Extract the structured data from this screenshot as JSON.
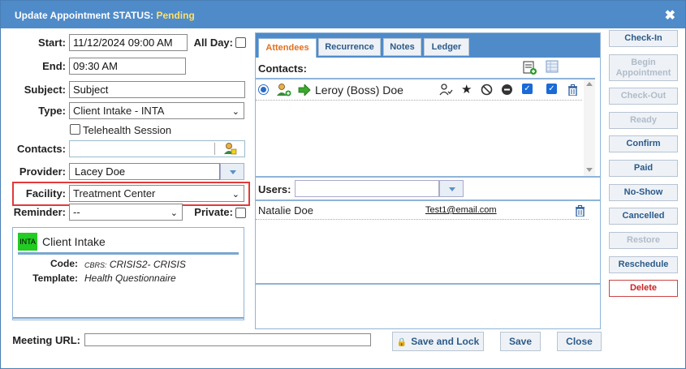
{
  "dialog": {
    "title_prefix": "Update Appointment STATUS: ",
    "status": "Pending",
    "close_glyph": "✖"
  },
  "form": {
    "start_label": "Start:",
    "start_value": "11/12/2024 09:00 AM",
    "allday_label": "All Day:",
    "end_label": "End:",
    "end_value": "09:30 AM",
    "subject_label": "Subject:",
    "subject_value": "Subject",
    "type_label": "Type:",
    "type_value": "Client Intake - INTA",
    "telehealth_label": "Telehealth Session",
    "contacts_label": "Contacts:",
    "provider_label": "Provider:",
    "provider_value": "Lacey Doe",
    "facility_label": "Facility:",
    "facility_value": "Treatment Center",
    "reminder_label": "Reminder:",
    "reminder_value": "--",
    "private_label": "Private:",
    "meeting_url_label": "Meeting URL:"
  },
  "type_card": {
    "badge": "INTA",
    "badge_color": "#22cc22",
    "title": "Client Intake",
    "code_label": "Code:",
    "code_prefix": "CBRS:",
    "code_value": " CRISIS2- CRISIS",
    "template_label": "Template:",
    "template_value": "Health Questionnaire"
  },
  "tabs": [
    {
      "label": "Attendees",
      "active": true
    },
    {
      "label": "Recurrence",
      "active": false
    },
    {
      "label": "Notes",
      "active": false
    },
    {
      "label": "Ledger",
      "active": false
    }
  ],
  "attendees": {
    "contacts_heading": "Contacts:",
    "contact_name": "Leroy (Boss) Doe",
    "users_label": "Users:",
    "user_name": "Natalie Doe",
    "user_email": "Test1@email.com"
  },
  "actions": {
    "check_in": "Check-In",
    "begin": "Begin Appointment",
    "check_out": "Check-Out",
    "ready": "Ready",
    "confirm": "Confirm",
    "paid": "Paid",
    "no_show": "No-Show",
    "cancelled": "Cancelled",
    "restore": "Restore",
    "reschedule": "Reschedule",
    "delete": "Delete"
  },
  "footer": {
    "save_lock": "Save and Lock",
    "save": "Save",
    "close": "Close"
  },
  "colors": {
    "accent": "#4f8bc9",
    "highlight": "#e23a3a"
  }
}
